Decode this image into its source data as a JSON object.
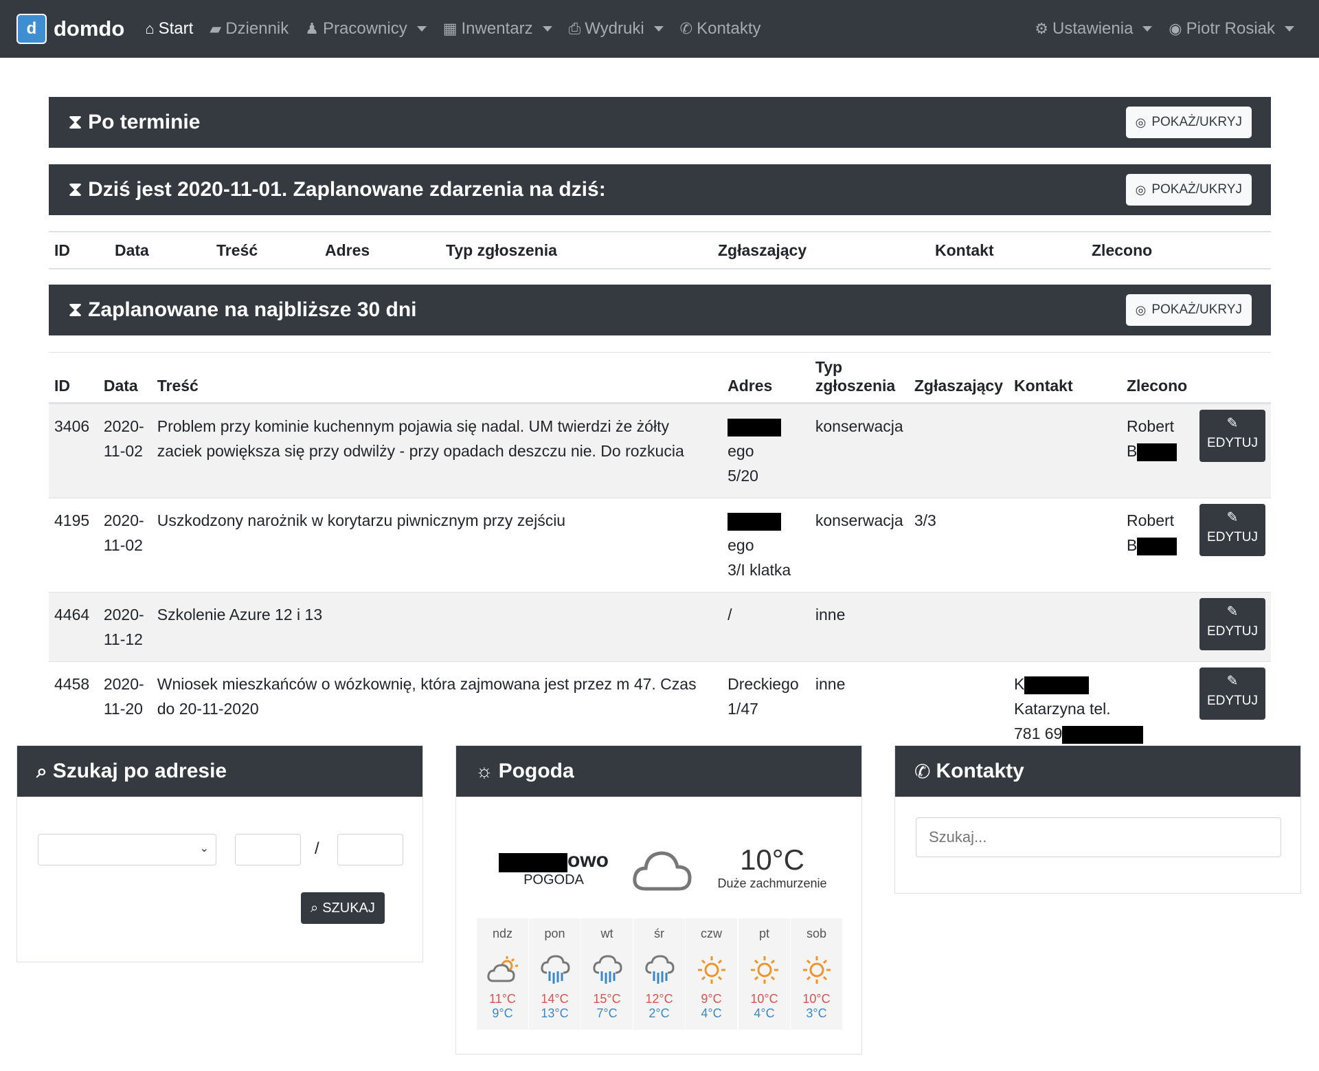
{
  "nav": {
    "brand": "domdo",
    "items": [
      {
        "label": "Start",
        "icon": "home-icon",
        "active": true
      },
      {
        "label": "Dziennik",
        "icon": "book-icon"
      },
      {
        "label": "Pracownicy",
        "icon": "person-icon",
        "dropdown": true
      },
      {
        "label": "Inwentarz",
        "icon": "building-icon",
        "dropdown": true
      },
      {
        "label": "Wydruki",
        "icon": "printer-icon",
        "dropdown": true
      },
      {
        "label": "Kontakty",
        "icon": "phone-icon"
      }
    ],
    "settings": "Ustawienia",
    "user": "Piotr Rosiak"
  },
  "sections": {
    "overdue": {
      "title": "Po terminie",
      "toggle": "POKAŻ/UKRYJ"
    },
    "today": {
      "title": "Dziś jest 2020-11-01. Zaplanowane zdarzenia na dziś:",
      "toggle": "POKAŻ/UKRYJ"
    },
    "next30": {
      "title": "Zaplanowane na najbliższe 30 dni",
      "toggle": "POKAŻ/UKRYJ"
    }
  },
  "today_table": {
    "headers": [
      "ID",
      "Data",
      "Treść",
      "Adres",
      "Typ zgłoszenia",
      "Zgłaszający",
      "Kontakt",
      "Zlecono"
    ]
  },
  "events_table": {
    "headers": [
      "ID",
      "Data",
      "Treść",
      "Adres",
      "Typ zgłoszenia",
      "Zgłaszający",
      "Kontakt",
      "Zlecono"
    ],
    "edit_label": "EDYTUJ",
    "rows": [
      {
        "id": "3406",
        "date": "2020-11-02",
        "content": "Problem przy kominie kuchennym pojawia się nadal. UM twierdzi że żółty zaciek powiększa się przy odwilży - przy opadach deszczu nie. Do rozkucia",
        "addr1": "ego",
        "addr2": "5/20",
        "type": "konserwacja",
        "reporter": "",
        "contact": "",
        "assigned1": "Robert",
        "assigned2": "B"
      },
      {
        "id": "4195",
        "date": "2020-11-02",
        "content": "Uszkodzony narożnik w korytarzu piwnicznym przy zejściu",
        "addr1": "ego",
        "addr2": "3/I klatka",
        "type": "konserwacja",
        "reporter": "3/3",
        "contact": "",
        "assigned1": "Robert",
        "assigned2": "B"
      },
      {
        "id": "4464",
        "date": "2020-11-12",
        "content": "Szkolenie Azure 12 i 13",
        "addr1": "/",
        "addr2": "",
        "type": "inne",
        "reporter": "",
        "contact": "",
        "assigned1": "",
        "assigned2": ""
      },
      {
        "id": "4458",
        "date": "2020-11-20",
        "content": "Wniosek mieszkańców o wózkownię, która zajmowana jest przez m 47. Czas do 20-11-2020",
        "addr1": "Dreckiego",
        "addr2": "1/47",
        "type": "inne",
        "reporter": "",
        "contact1": "K",
        "contact2": "Katarzyna tel.",
        "contact3": "781 69",
        "assigned1": "",
        "assigned2": ""
      }
    ]
  },
  "search_card": {
    "title": "Szukaj po adresie",
    "slash": "/",
    "button": "SZUKAJ"
  },
  "weather_card": {
    "title": "Pogoda",
    "city_suffix": "owo",
    "subtitle": "POGODA",
    "temp": "10°C",
    "desc": "Duże zachmurzenie",
    "days": [
      {
        "d": "ndz",
        "hi": "11°C",
        "lo": "9°C",
        "icon": "partly-cloudy-icon"
      },
      {
        "d": "pon",
        "hi": "14°C",
        "lo": "13°C",
        "icon": "rain-icon"
      },
      {
        "d": "wt",
        "hi": "15°C",
        "lo": "7°C",
        "icon": "rain-icon"
      },
      {
        "d": "śr",
        "hi": "12°C",
        "lo": "2°C",
        "icon": "rain-icon"
      },
      {
        "d": "czw",
        "hi": "9°C",
        "lo": "4°C",
        "icon": "sun-icon"
      },
      {
        "d": "pt",
        "hi": "10°C",
        "lo": "4°C",
        "icon": "sun-icon"
      },
      {
        "d": "sob",
        "hi": "10°C",
        "lo": "3°C",
        "icon": "sun-icon"
      }
    ]
  },
  "contacts_card": {
    "title": "Kontakty",
    "placeholder": "Szukaj..."
  }
}
